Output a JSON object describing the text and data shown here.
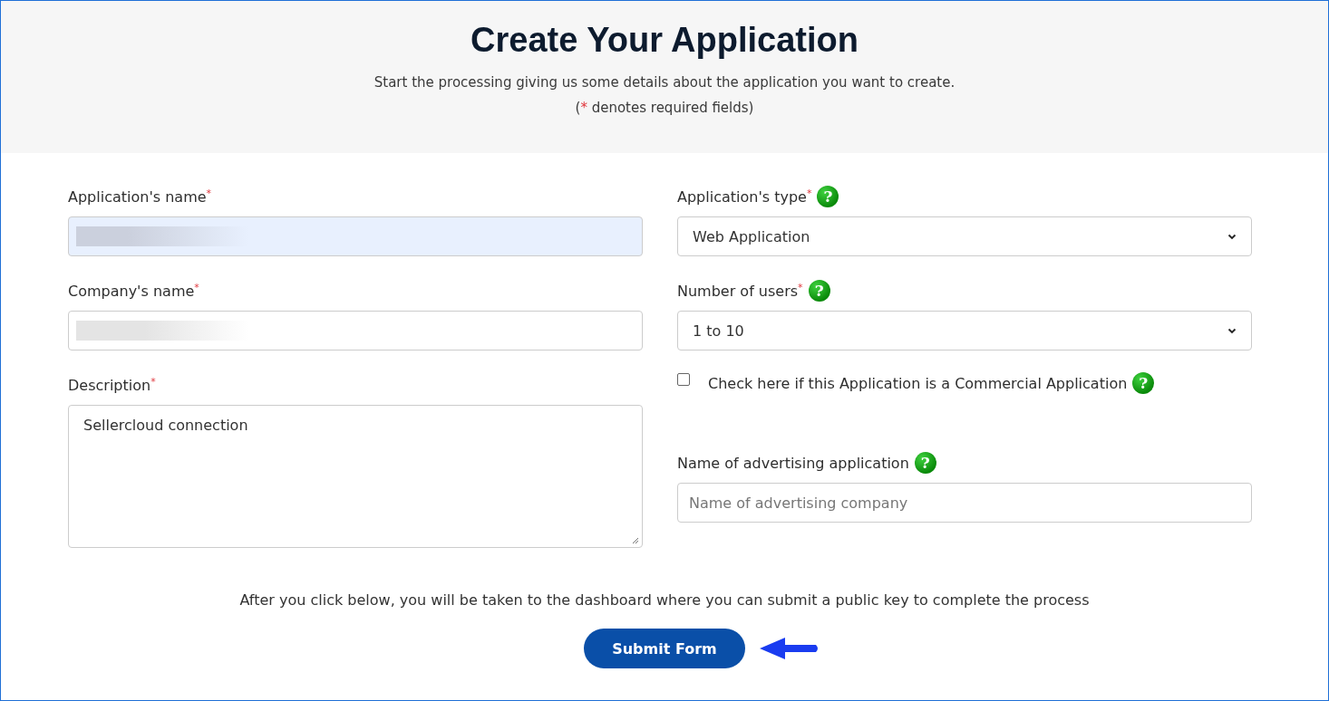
{
  "header": {
    "title": "Create Your Application",
    "subtitle": "Start the processing giving us some details about the application you want to create.",
    "required_note": {
      "open": "(",
      "mark": "*",
      "text": "denotes required fields)"
    }
  },
  "left_fields": [
    {
      "kind": "text",
      "label": "Application's name",
      "required": true,
      "value_hidden": true,
      "autofilled": true
    },
    {
      "kind": "text",
      "label": "Company's name",
      "required": true,
      "value_hidden": true,
      "autofilled": false
    },
    {
      "kind": "textarea",
      "label": "Description",
      "required": true,
      "value": "Sellercloud connection"
    }
  ],
  "right_fields": [
    {
      "kind": "select",
      "label": "Application's type",
      "required": true,
      "help": "?",
      "value": "Web Application"
    },
    {
      "kind": "select",
      "label": "Number of users",
      "required": true,
      "help": "?",
      "value": "1 to 10"
    },
    {
      "kind": "checkbox",
      "label": "Check here if this Application is a Commercial Application",
      "checked": false,
      "help": "?"
    },
    {
      "kind": "text",
      "label": "Name of advertising application",
      "required": false,
      "help": "?",
      "placeholder": "Name of advertising company"
    }
  ],
  "footer_note": "After you click below, you will be taken to the dashboard where you can submit a public key to complete the process",
  "submit": {
    "label": "Submit Form",
    "pointer_arrow": true
  }
}
